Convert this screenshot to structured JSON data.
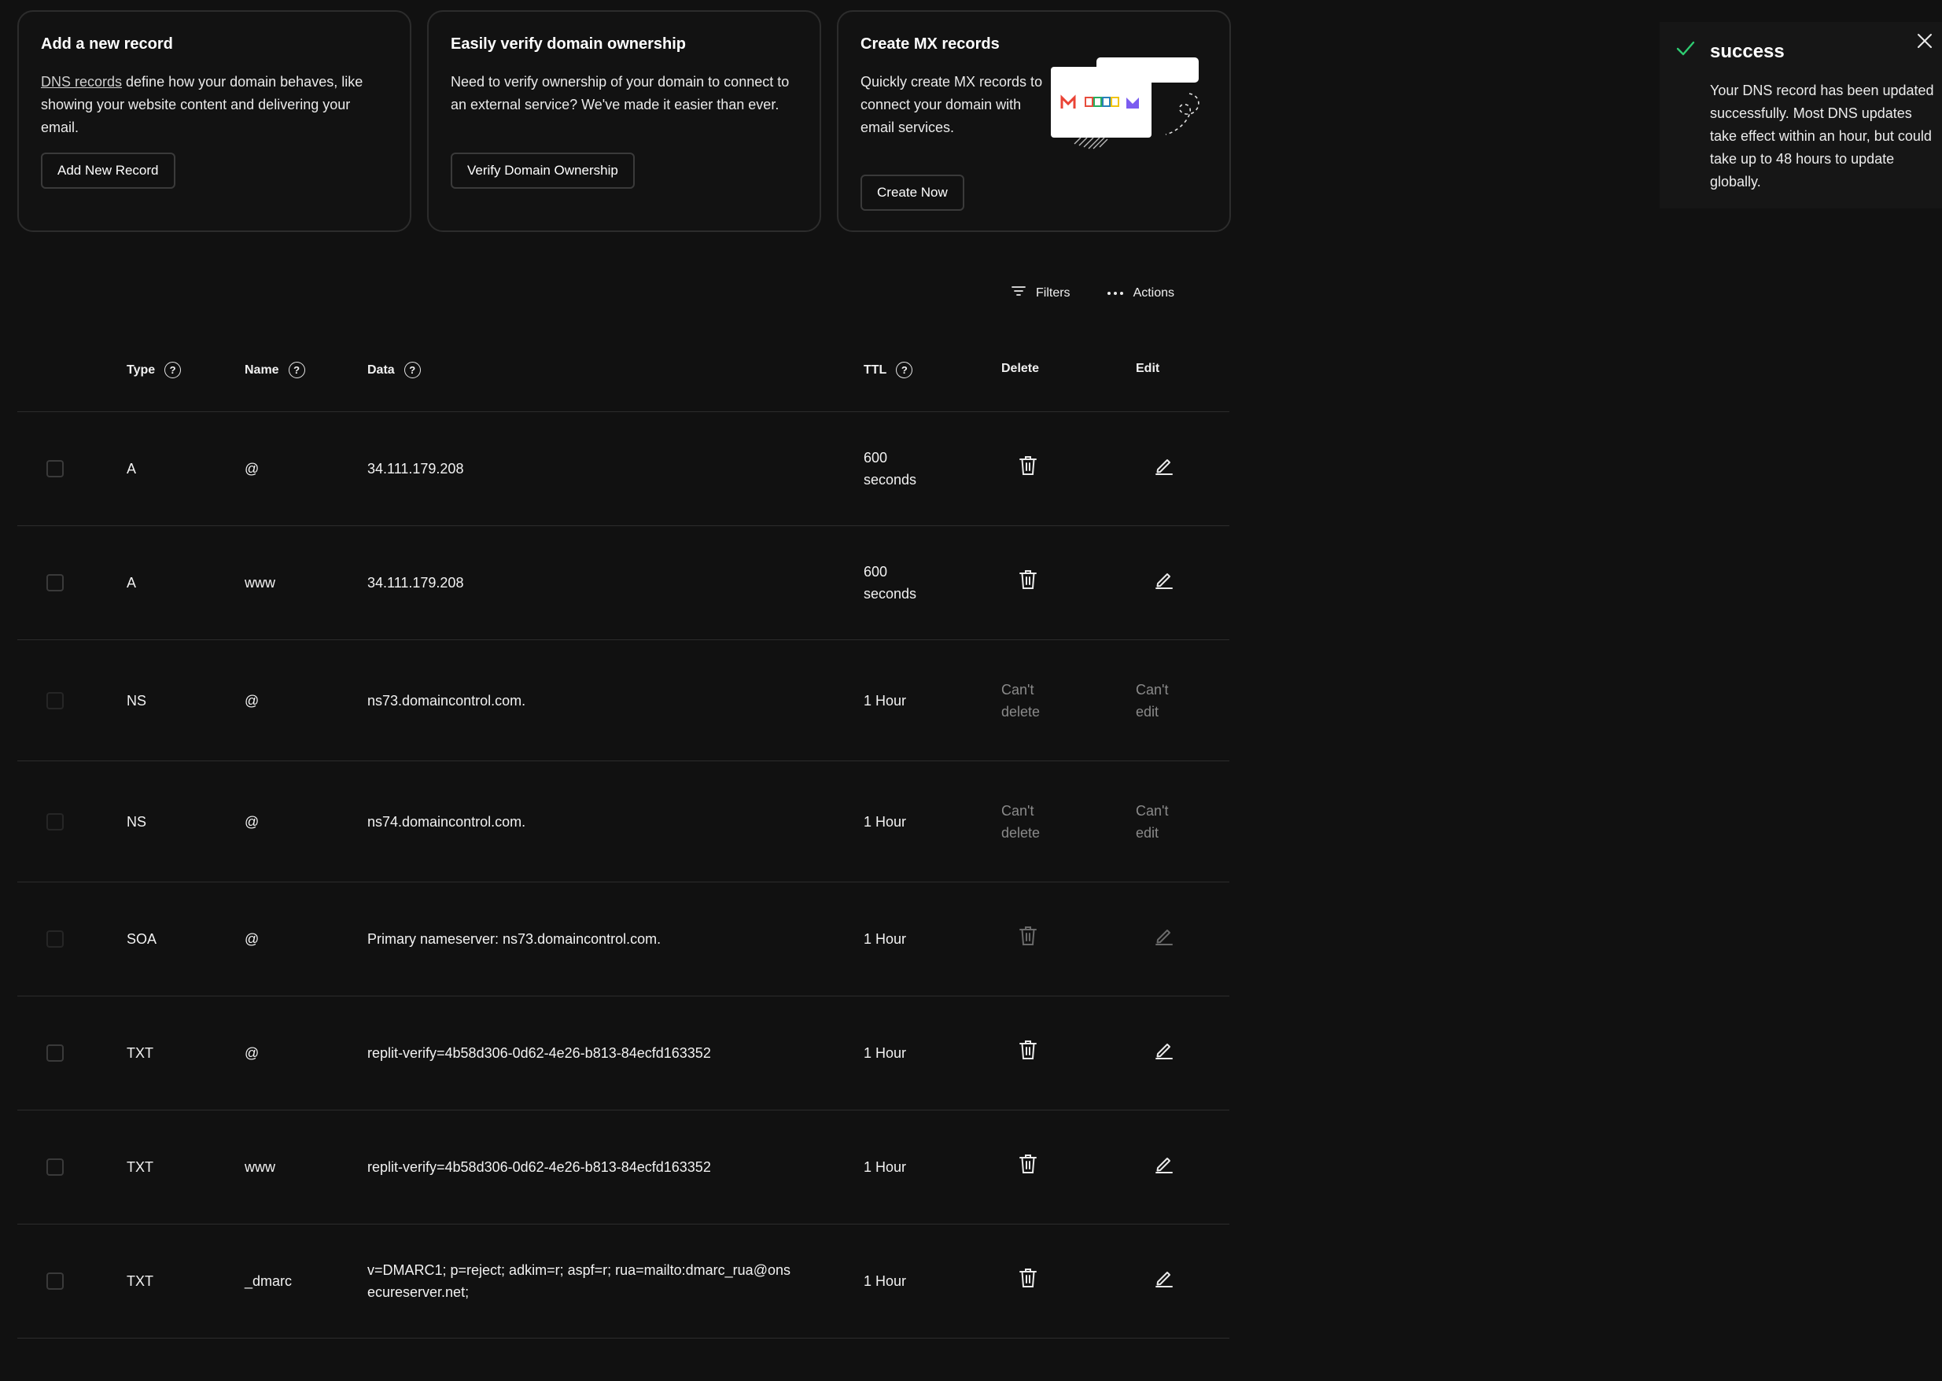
{
  "cards": {
    "add_record": {
      "title": "Add a new record",
      "link_text": "DNS records",
      "body": " define how your domain behaves, like showing your website content and delivering your email.",
      "button": "Add New Record"
    },
    "verify": {
      "title": "Easily verify domain ownership",
      "body": "Need to verify ownership of your domain to connect to an external service? We've made it easier than ever.",
      "button": "Verify Domain Ownership"
    },
    "mx": {
      "title": "Create MX records",
      "body": "Quickly create MX records to connect your domain with email services.",
      "button": "Create Now"
    }
  },
  "toolbar": {
    "filters_label": "Filters",
    "actions_label": "Actions"
  },
  "table": {
    "headers": {
      "type": "Type",
      "name": "Name",
      "data": "Data",
      "ttl": "TTL",
      "delete": "Delete",
      "edit": "Edit"
    },
    "rows": [
      {
        "type": "A",
        "name": "@",
        "data": "34.111.179.208",
        "ttl": "600 seconds"
      },
      {
        "type": "A",
        "name": "www",
        "data": "34.111.179.208",
        "ttl": "600 seconds"
      },
      {
        "type": "NS",
        "name": "@",
        "data": "ns73.domaincontrol.com.",
        "ttl": "1 Hour",
        "delete_text": "Can't delete",
        "edit_text": "Can't edit"
      },
      {
        "type": "NS",
        "name": "@",
        "data": "ns74.domaincontrol.com.",
        "ttl": "1 Hour",
        "delete_text": "Can't delete",
        "edit_text": "Can't edit"
      },
      {
        "type": "SOA",
        "name": "@",
        "data": "Primary nameserver: ns73.domaincontrol.com.",
        "ttl": "1 Hour"
      },
      {
        "type": "TXT",
        "name": "@",
        "data": "replit-verify=4b58d306-0d62-4e26-b813-84ecfd163352",
        "ttl": "1 Hour"
      },
      {
        "type": "TXT",
        "name": "www",
        "data": "replit-verify=4b58d306-0d62-4e26-b813-84ecfd163352",
        "ttl": "1 Hour"
      },
      {
        "type": "TXT",
        "name": "_dmarc",
        "data": "v=DMARC1; p=reject; adkim=r; aspf=r; rua=mailto:dmarc_rua@onsecureserver.net;",
        "ttl": "1 Hour"
      }
    ]
  },
  "toast": {
    "title": "success",
    "message": "Your DNS record has been updated successfully. Most DNS updates take effect within an hour, but could take up to 48 hours to update globally."
  },
  "icons": {
    "check": "check-icon",
    "close": "close-icon",
    "filter": "filter-icon",
    "more": "more-horizontal-icon",
    "trash": "trash-icon",
    "pencil": "pencil-icon",
    "help": "help-circle-icon"
  },
  "colors": {
    "background": "#111111",
    "border": "#2c2c2c",
    "success": "#2ecc71",
    "muted": "#8a8a8a"
  }
}
